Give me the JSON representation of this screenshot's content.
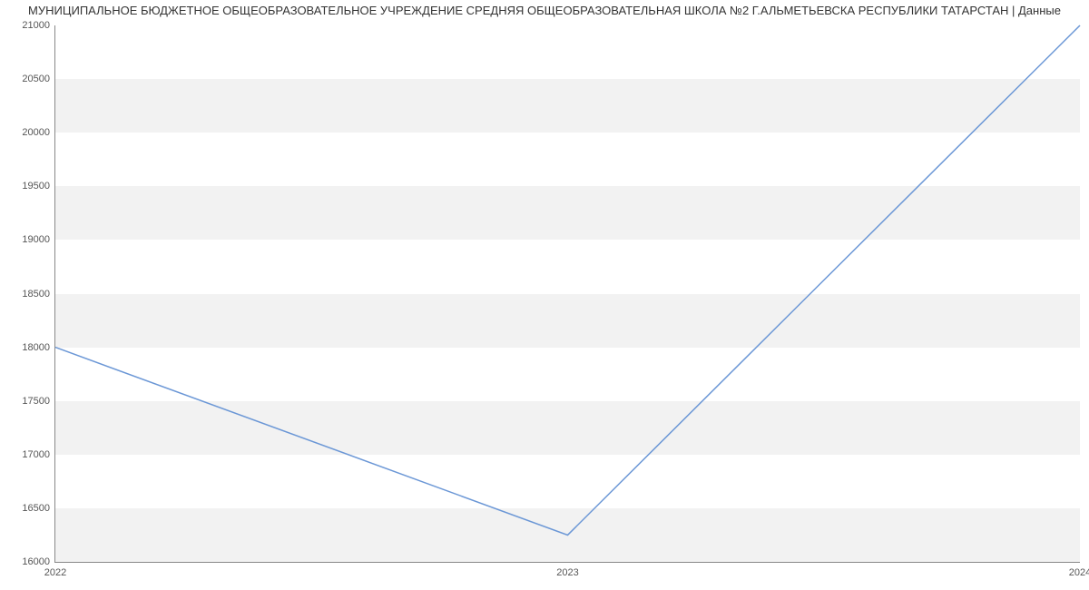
{
  "chart_data": {
    "type": "line",
    "title": "МУНИЦИПАЛЬНОЕ БЮДЖЕТНОЕ ОБЩЕОБРАЗОВАТЕЛЬНОЕ УЧРЕЖДЕНИЕ СРЕДНЯЯ ОБЩЕОБРАЗОВАТЕЛЬНАЯ ШКОЛА №2 Г.АЛЬМЕТЬЕВСКА РЕСПУБЛИКИ ТАТАРСТАН | Данные",
    "x": [
      "2022",
      "2023",
      "2024"
    ],
    "values": [
      18000,
      16250,
      21000
    ],
    "ylim": [
      16000,
      21000
    ],
    "y_ticks": [
      16000,
      16500,
      17000,
      17500,
      18000,
      18500,
      19000,
      19500,
      20000,
      20500,
      21000
    ],
    "x_ticks": [
      "2022",
      "2023",
      "2024"
    ],
    "xlabel": "",
    "ylabel": "",
    "line_color": "#6b97d6"
  }
}
